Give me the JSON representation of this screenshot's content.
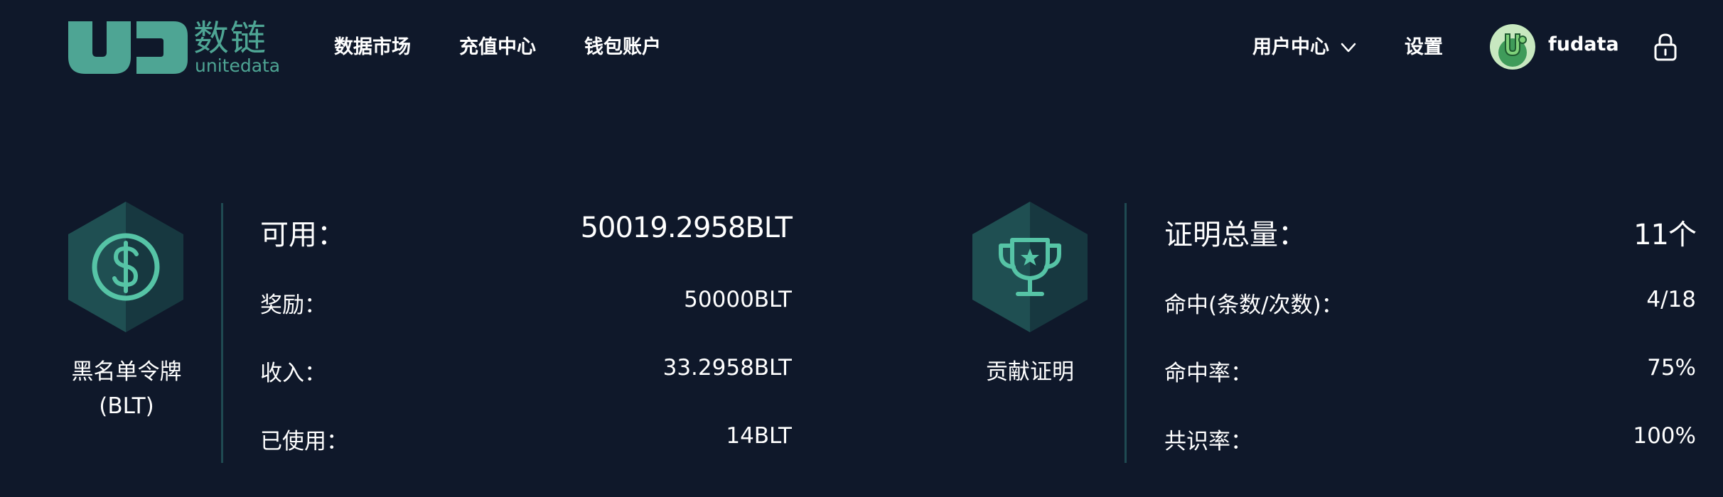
{
  "logo": {
    "cn": "数链",
    "en": "unitedata",
    "accent": "#4ea594"
  },
  "nav": {
    "items": [
      {
        "label": "数据市场"
      },
      {
        "label": "充值中心"
      },
      {
        "label": "钱包账户"
      }
    ],
    "user_center": "用户中心",
    "settings": "设置",
    "username": "fudata"
  },
  "token_card": {
    "name_line1": "黑名单令牌",
    "name_line2": "(BLT)",
    "icon": "dollar-icon",
    "rows": [
      {
        "label": "可用：",
        "value": "50019.2958BLT"
      },
      {
        "label": "奖励：",
        "value": "50000BLT"
      },
      {
        "label": "收入：",
        "value": "33.2958BLT"
      },
      {
        "label": "已使用：",
        "value": "14BLT"
      }
    ]
  },
  "proof_card": {
    "name": "贡献证明",
    "icon": "trophy-icon",
    "rows": [
      {
        "label": "证明总量：",
        "value": "11个"
      },
      {
        "label": "命中(条数/次数)：",
        "value": "4/18"
      },
      {
        "label": "命中率：",
        "value": "75%"
      },
      {
        "label": "共识率：",
        "value": "100%"
      }
    ]
  },
  "colors": {
    "background": "#0f182a",
    "accent": "#4ea594",
    "divider": "#1f4a52",
    "hex_left": "#1f4f52",
    "hex_right": "#173840"
  }
}
